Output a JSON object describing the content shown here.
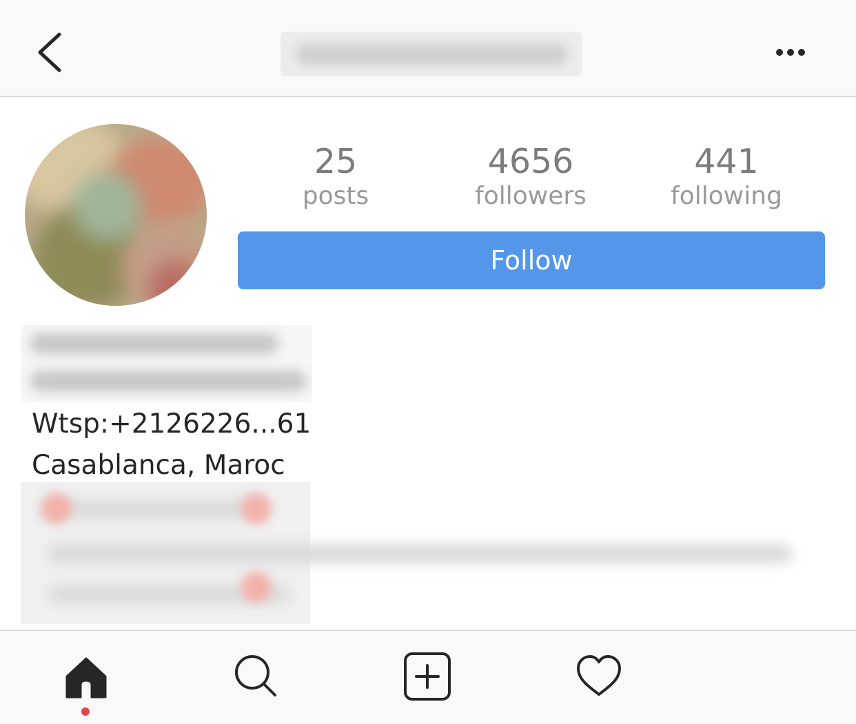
{
  "header": {
    "back_icon": "chevron-left-icon",
    "username_obscured": true,
    "more_icon": "ellipsis-horizontal-icon"
  },
  "profile": {
    "avatar_obscured": true,
    "stats": [
      {
        "key": "posts",
        "value": "25",
        "label": "posts"
      },
      {
        "key": "followers",
        "value": "4656",
        "label": "followers"
      },
      {
        "key": "following",
        "value": "441",
        "label": "following"
      }
    ],
    "follow_label": "Follow",
    "follow_color": "#5497ea"
  },
  "bio": {
    "name_obscured": true,
    "whatsapp": "Wtsp:+2126226...61",
    "location": "Casablanca, Maroc",
    "description_obscured": true
  },
  "tabbar": {
    "items": [
      {
        "key": "home",
        "icon": "home-icon",
        "active": true
      },
      {
        "key": "search",
        "icon": "search-icon",
        "active": false
      },
      {
        "key": "add",
        "icon": "add-post-icon",
        "active": false
      },
      {
        "key": "activity",
        "icon": "heart-icon",
        "active": false
      }
    ],
    "notification_dot_color": "#e0434a"
  }
}
